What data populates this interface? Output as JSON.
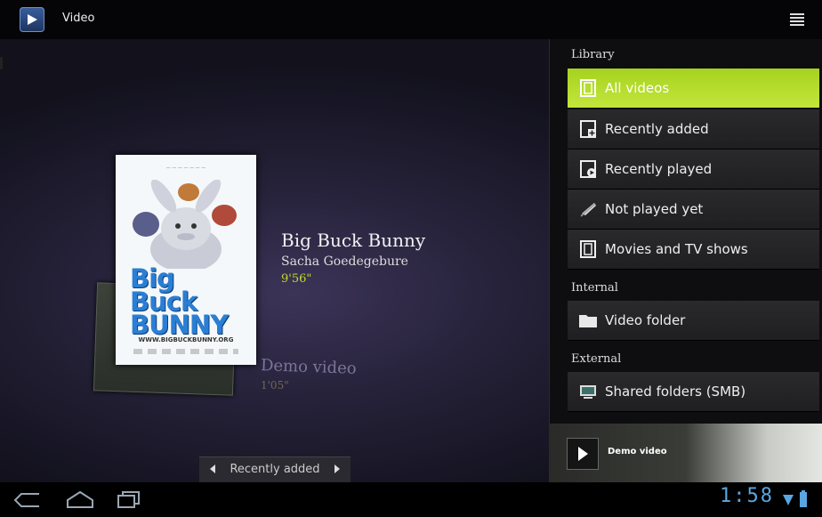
{
  "app": {
    "title": "Video"
  },
  "featured": {
    "title": "Big Buck Bunny",
    "subtitle": "Sacha Goedegebure",
    "duration": "9'56\"",
    "poster_text": "Big Buck BUNNY",
    "poster_url": "WWW.BIGBUCKBUNNY.ORG"
  },
  "next_item": {
    "title": "Demo video",
    "duration": "1'05\""
  },
  "pager": {
    "label": "Recently added"
  },
  "panel": {
    "sections": [
      {
        "label": "Library"
      },
      {
        "label": "Internal"
      },
      {
        "label": "External"
      }
    ],
    "items": [
      {
        "label": "All videos",
        "icon": "film-icon"
      },
      {
        "label": "Recently added",
        "icon": "film-add-icon"
      },
      {
        "label": "Recently played",
        "icon": "film-play-icon"
      },
      {
        "label": "Not played yet",
        "icon": "not-played-icon"
      },
      {
        "label": "Movies and TV shows",
        "icon": "film-icon"
      },
      {
        "label": "Video folder",
        "icon": "folder-icon"
      },
      {
        "label": "Shared folders (SMB)",
        "icon": "network-icon"
      }
    ]
  },
  "now_playing": {
    "title": "Demo video"
  },
  "status": {
    "time": "1:58"
  },
  "colors": {
    "accent": "#b4dc2a",
    "duration": "#c8d92a",
    "clock": "#5aa6e0"
  }
}
